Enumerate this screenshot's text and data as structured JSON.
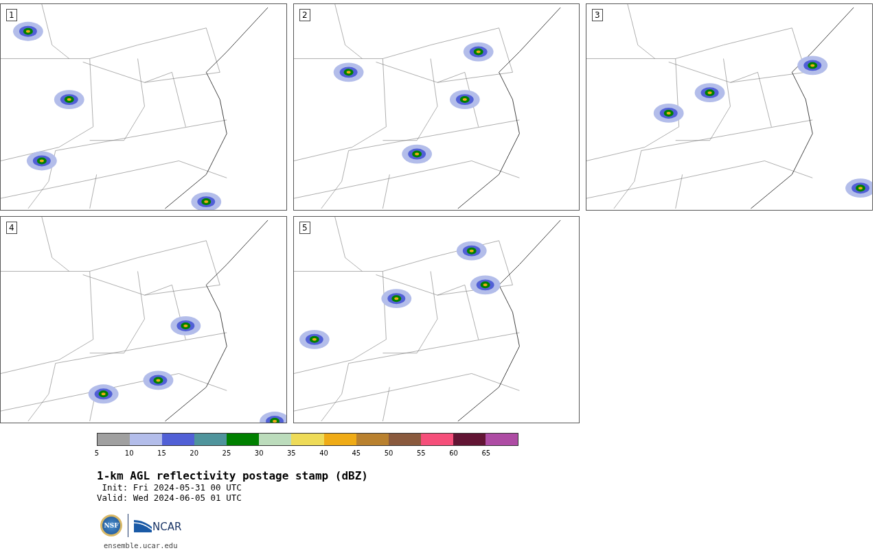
{
  "panels": [
    {
      "label": "1"
    },
    {
      "label": "2"
    },
    {
      "label": "3"
    },
    {
      "label": "4"
    },
    {
      "label": "5"
    }
  ],
  "colorbar": {
    "segments": [
      {
        "color": "#a0a0a0",
        "tick": "5"
      },
      {
        "color": "#b3bdea",
        "tick": "10"
      },
      {
        "color": "#5160d6",
        "tick": "15"
      },
      {
        "color": "#4f949c",
        "tick": "20"
      },
      {
        "color": "#008000",
        "tick": "25"
      },
      {
        "color": "#bcdcbc",
        "tick": "30"
      },
      {
        "color": "#eedb58",
        "tick": "35"
      },
      {
        "color": "#efab16",
        "tick": "40"
      },
      {
        "color": "#b9812f",
        "tick": "45"
      },
      {
        "color": "#8a5a3e",
        "tick": "50"
      },
      {
        "color": "#f54f7a",
        "tick": "55"
      },
      {
        "color": "#621534",
        "tick": "60"
      },
      {
        "color": "#ae4ca4",
        "tick": "65"
      }
    ]
  },
  "title": "1-km AGL reflectivity postage stamp (dBZ)",
  "init": " Init: Fri 2024-05-31 00 UTC",
  "valid": "Valid: Wed 2024-06-05 01 UTC",
  "logos": {
    "nsf": "NSF",
    "ncar": "NCAR"
  },
  "url": "ensemble.ucar.edu"
}
